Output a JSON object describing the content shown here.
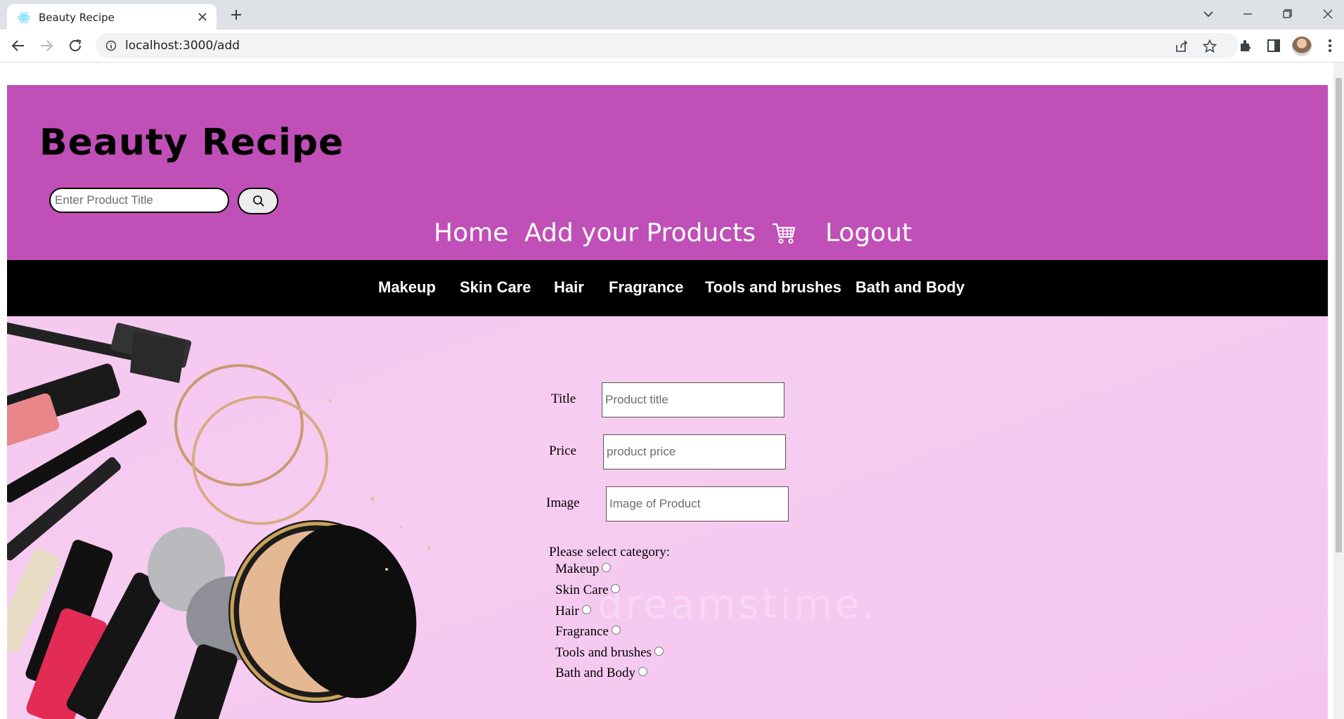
{
  "browser": {
    "tab_title": "Beauty Recipe",
    "url": "localhost:3000/add"
  },
  "header": {
    "brand": "Beauty Recipe",
    "search_placeholder": "Enter Product Title",
    "nav": [
      "Home",
      "Add your Products",
      "Logout"
    ]
  },
  "categories_bar": [
    "Makeup",
    "Skin Care",
    "Hair",
    "Fragrance",
    "Tools and brushes",
    "Bath and Body"
  ],
  "form": {
    "title_label": "Title",
    "title_placeholder": "Product title",
    "price_label": "Price",
    "price_placeholder": "product price",
    "image_label": "Image",
    "image_placeholder": "Image of Product",
    "category_prompt": "Please select category:",
    "category_options": [
      "Makeup",
      "Skin Care",
      "Hair",
      "Fragrance",
      "Tools and brushes",
      "Bath and Body"
    ]
  },
  "hero": {
    "watermark": "dreamstime."
  },
  "icons": {
    "favicon": "react-icon",
    "search": "search-icon",
    "cart": "cart-icon"
  },
  "colors": {
    "header_bg": "#c04fb8",
    "category_bar_bg": "#000000",
    "hero_bg": "#f6c9ef"
  }
}
